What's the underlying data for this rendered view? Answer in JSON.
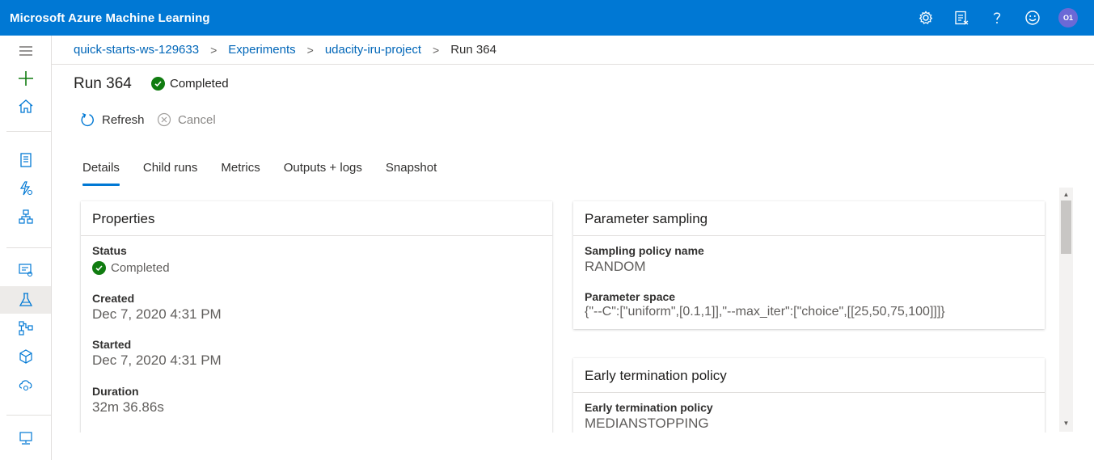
{
  "header": {
    "app_title": "Microsoft Azure Machine Learning",
    "avatar_initials": "O1",
    "icons": [
      "settings-icon",
      "feedback-icon",
      "help-icon",
      "smiley-icon"
    ]
  },
  "breadcrumb": {
    "items": [
      "quick-starts-ws-129633",
      "Experiments",
      "udacity-iru-project"
    ],
    "current": "Run 364"
  },
  "run": {
    "title": "Run 364",
    "status": "Completed"
  },
  "commands": {
    "refresh": "Refresh",
    "cancel": "Cancel"
  },
  "tabs": [
    "Details",
    "Child runs",
    "Metrics",
    "Outputs + logs",
    "Snapshot"
  ],
  "properties": {
    "title": "Properties",
    "status_label": "Status",
    "status_value": "Completed",
    "created_label": "Created",
    "created_value": "Dec 7, 2020 4:31 PM",
    "started_label": "Started",
    "started_value": "Dec 7, 2020 4:31 PM",
    "duration_label": "Duration",
    "duration_value": "32m 36.86s"
  },
  "parameter_sampling": {
    "title": "Parameter sampling",
    "policy_label": "Sampling policy name",
    "policy_value": "RANDOM",
    "space_label": "Parameter space",
    "space_value": "{\"--C\":[\"uniform\",[0.1,1]],\"--max_iter\":[\"choice\",[[25,50,75,100]]]}"
  },
  "early_termination": {
    "title": "Early termination policy",
    "policy_label": "Early termination policy",
    "policy_value": "MEDIANSTOPPING"
  },
  "colors": {
    "brand": "#0078d4",
    "success": "#107c10",
    "link": "#0066b8"
  }
}
